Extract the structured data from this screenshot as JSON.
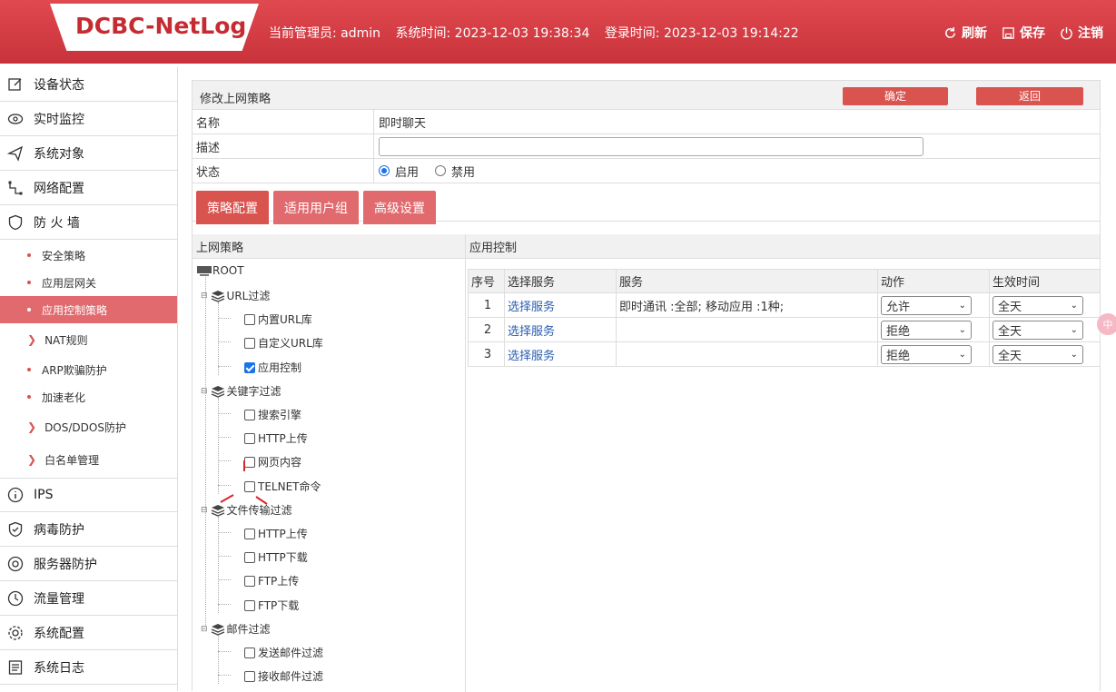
{
  "header": {
    "logo": "DCBC-NetLog",
    "admin": "当前管理员: admin",
    "system_time": "系统时间: 2023-12-03 19:38:34",
    "login_time": "登录时间: 2023-12-03 19:14:22",
    "refresh": "刷新",
    "save": "保存",
    "logout": "注销"
  },
  "sidebar": {
    "items": [
      {
        "label": "设备状态",
        "icon": "edit-icon"
      },
      {
        "label": "实时监控",
        "icon": "eye-icon"
      },
      {
        "label": "系统对象",
        "icon": "send-icon"
      },
      {
        "label": "网络配置",
        "icon": "network-icon"
      },
      {
        "label": "防 火 墙",
        "icon": "shield-icon"
      }
    ],
    "firewall_sub": [
      {
        "label": "安全策略",
        "type": "dot"
      },
      {
        "label": "应用层网关",
        "type": "dot"
      },
      {
        "label": "应用控制策略",
        "type": "dot",
        "active": true
      },
      {
        "label": "NAT规则",
        "type": "chevron"
      },
      {
        "label": "ARP欺骗防护",
        "type": "dot"
      },
      {
        "label": "加速老化",
        "type": "dot"
      },
      {
        "label": "DOS/DDOS防护",
        "type": "chevron"
      },
      {
        "label": "白名单管理",
        "type": "chevron"
      }
    ],
    "items2": [
      {
        "label": "IPS",
        "icon": "info-icon"
      },
      {
        "label": "病毒防护",
        "icon": "shield-check-icon"
      },
      {
        "label": "服务器防护",
        "icon": "target-icon"
      },
      {
        "label": "流量管理",
        "icon": "clock-icon"
      },
      {
        "label": "系统配置",
        "icon": "gear-icon"
      },
      {
        "label": "系统日志",
        "icon": "log-icon"
      }
    ]
  },
  "main": {
    "title": "修改上网策略",
    "confirm": "确定",
    "back": "返回",
    "name_label": "名称",
    "name_value": "即时聊天",
    "desc_label": "描述",
    "desc_value": "",
    "status_label": "状态",
    "status_on": "启用",
    "status_off": "禁用",
    "tabs": [
      "策略配置",
      "适用用户组",
      "高级设置"
    ],
    "left_header": "上网策略",
    "right_header": "应用控制"
  },
  "tree": {
    "root": "ROOT",
    "groups": [
      {
        "label": "URL过滤",
        "children": [
          {
            "label": "内置URL库",
            "checked": false
          },
          {
            "label": "自定义URL库",
            "checked": false
          },
          {
            "label": "应用控制",
            "checked": true
          }
        ]
      },
      {
        "label": "关键字过滤",
        "children": [
          {
            "label": "搜索引擎",
            "checked": false
          },
          {
            "label": "HTTP上传",
            "checked": false
          },
          {
            "label": "网页内容",
            "checked": false
          },
          {
            "label": "TELNET命令",
            "checked": false
          }
        ]
      },
      {
        "label": "文件传输过滤",
        "children": [
          {
            "label": "HTTP上传",
            "checked": false
          },
          {
            "label": "HTTP下载",
            "checked": false
          },
          {
            "label": "FTP上传",
            "checked": false
          },
          {
            "label": "FTP下载",
            "checked": false
          }
        ]
      },
      {
        "label": "邮件过滤",
        "children": [
          {
            "label": "发送邮件过滤",
            "checked": false
          },
          {
            "label": "接收邮件过滤",
            "checked": false
          }
        ]
      }
    ]
  },
  "table": {
    "headers": [
      "序号",
      "选择服务",
      "服务",
      "动作",
      "生效时间"
    ],
    "rows": [
      {
        "no": "1",
        "select": "选择服务",
        "service": "即时通讯 :全部; 移动应用 :1种;",
        "action": "允许",
        "time": "全天"
      },
      {
        "no": "2",
        "select": "选择服务",
        "service": "",
        "action": "拒绝",
        "time": "全天"
      },
      {
        "no": "3",
        "select": "选择服务",
        "service": "",
        "action": "拒绝",
        "time": "全天"
      }
    ]
  },
  "float_badge": "中",
  "colors": {
    "brand": "#c8323a",
    "accent": "#d9534f",
    "active": "#e06a6e",
    "link": "#2a5db0"
  }
}
